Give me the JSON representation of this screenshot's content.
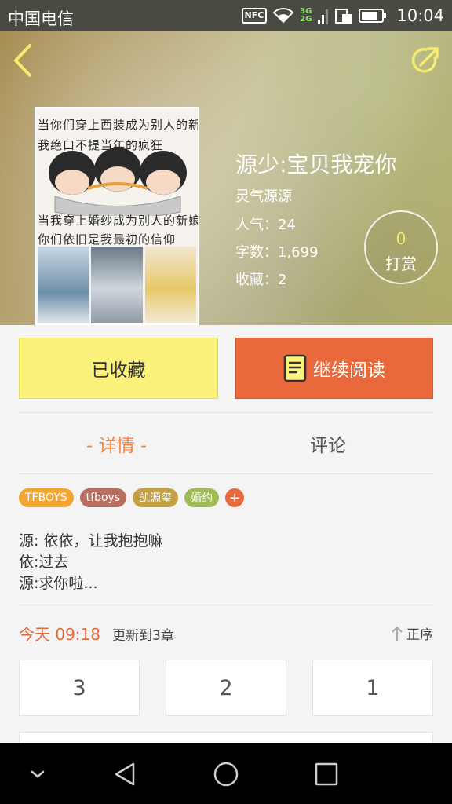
{
  "status_bar": {
    "carrier": "中国电信",
    "nfc": "NFC",
    "net_top": "3G",
    "net_bottom": "2G",
    "time": "10:04"
  },
  "header": {
    "back_icon": "back-chevron-icon",
    "share_icon": "share-icon",
    "accent": "#f6ea6f"
  },
  "cover": {
    "line1": "当你们穿上西装成为别人的新郎",
    "line2": "我绝口不提当年的疯狂",
    "line3": "当我穿上婚纱成为别人的新娘",
    "line4": "你们依旧是我最初的信仰"
  },
  "book": {
    "title": "源少:宝贝我宠你",
    "author": "灵气源源",
    "popularity": "人气：24",
    "word_count": "字数：1,699",
    "favorites": "收藏：2"
  },
  "tip": {
    "count": "0",
    "label": "打赏"
  },
  "actions": {
    "favorite_label": "已收藏",
    "read_label": "继续阅读",
    "read_icon": "book-icon"
  },
  "tabs": {
    "detail": "- 详情 -",
    "comment": "评论"
  },
  "tags": [
    {
      "label": "TFBOYS",
      "color": "#f2a531"
    },
    {
      "label": "tfboys",
      "color": "#b86f5f"
    },
    {
      "label": "凯源玺",
      "color": "#c4a041"
    },
    {
      "label": "婚约",
      "color": "#9ebb57"
    }
  ],
  "tag_more": "+",
  "description": "源: 依依，让我抱抱嘛\n依:过去\n源:求你啦...",
  "update": {
    "time": "今天 09:18",
    "text": "更新到3章",
    "sort_label": "正序",
    "sort_icon": "up-arrow-icon"
  },
  "chapters": [
    "3",
    "2",
    "1"
  ],
  "navbar": {
    "back": "nav-back-icon",
    "home": "nav-home-icon",
    "recents": "nav-recents-icon",
    "down": "nav-down-icon"
  }
}
